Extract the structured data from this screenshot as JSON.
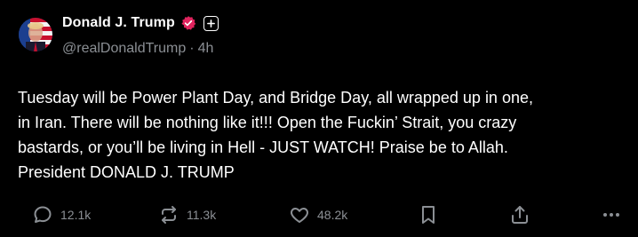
{
  "post": {
    "display_name": "Donald J. Trump",
    "handle": "@realDonaldTrump",
    "separator": "·",
    "time": "4h",
    "text": "Tuesday will be Power Plant Day, and Bridge Day, all wrapped up in one,\nin Iran. There will be nothing like it!!! Open the Fuckin’ Strait, you crazy\nbastards, or you’ll be living in Hell - JUST WATCH! Praise be to Allah.\nPresident DONALD J. TRUMP"
  },
  "actions": {
    "replies": "12.1k",
    "reposts": "11.3k",
    "likes": "48.2k"
  },
  "icons": {
    "avatar": "avatar-image",
    "verified": "verified-badge-icon",
    "follow": "plus-icon",
    "reply": "speech-bubble-icon",
    "repost": "repost-arrows-icon",
    "like": "heart-icon",
    "bookmark": "bookmark-icon",
    "share": "share-upload-icon",
    "more": "ellipsis-icon"
  },
  "colors": {
    "background": "#000000",
    "text": "#ffffff",
    "muted": "#8b8f94",
    "verified": "#e0245e"
  }
}
